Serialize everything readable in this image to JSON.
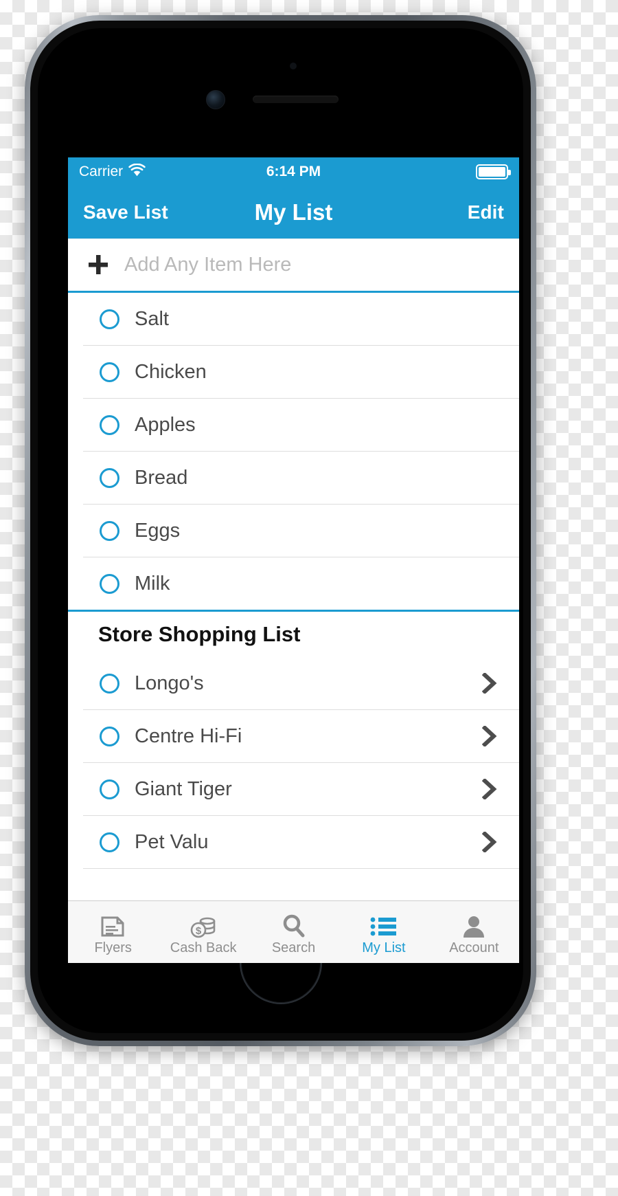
{
  "status_bar": {
    "carrier": "Carrier",
    "wifi_icon": "wifi-icon",
    "time": "6:14 PM",
    "battery_icon": "battery-full-icon"
  },
  "nav_bar": {
    "left_button": "Save List",
    "title": "My List",
    "right_button": "Edit"
  },
  "add_row": {
    "plus_icon": "plus-icon",
    "placeholder": "Add Any Item Here",
    "value": ""
  },
  "my_items": [
    {
      "label": "Salt",
      "checked": false,
      "checkbox_icon": "circle-outline-icon"
    },
    {
      "label": "Chicken",
      "checked": false,
      "checkbox_icon": "circle-outline-icon"
    },
    {
      "label": "Apples",
      "checked": false,
      "checkbox_icon": "circle-outline-icon"
    },
    {
      "label": "Bread",
      "checked": false,
      "checkbox_icon": "circle-outline-icon"
    },
    {
      "label": "Eggs",
      "checked": false,
      "checkbox_icon": "circle-outline-icon"
    },
    {
      "label": "Milk",
      "checked": false,
      "checkbox_icon": "circle-outline-icon"
    }
  ],
  "store_section": {
    "header": "Store Shopping List",
    "stores": [
      {
        "label": "Longo's",
        "checked": false,
        "checkbox_icon": "circle-outline-icon",
        "disclosure_icon": "chevron-right-icon"
      },
      {
        "label": "Centre Hi-Fi",
        "checked": false,
        "checkbox_icon": "circle-outline-icon",
        "disclosure_icon": "chevron-right-icon"
      },
      {
        "label": "Giant Tiger",
        "checked": false,
        "checkbox_icon": "circle-outline-icon",
        "disclosure_icon": "chevron-right-icon"
      },
      {
        "label": "Pet Valu",
        "checked": false,
        "checkbox_icon": "circle-outline-icon",
        "disclosure_icon": "chevron-right-icon"
      }
    ]
  },
  "tab_bar": {
    "active_index": 3,
    "tabs": [
      {
        "label": "Flyers",
        "icon": "flyer-document-icon"
      },
      {
        "label": "Cash Back",
        "icon": "coins-dollar-icon"
      },
      {
        "label": "Search",
        "icon": "magnifier-icon"
      },
      {
        "label": "My List",
        "icon": "bulleted-list-icon"
      },
      {
        "label": "Account",
        "icon": "person-icon"
      }
    ]
  },
  "colors": {
    "accent": "#1b9bd1",
    "tabbar_bg": "#f7f7f7",
    "tab_inactive": "#8e8e8e",
    "text": "#4a4a4a",
    "placeholder": "#b9b9b9",
    "separator": "#dddddd"
  }
}
